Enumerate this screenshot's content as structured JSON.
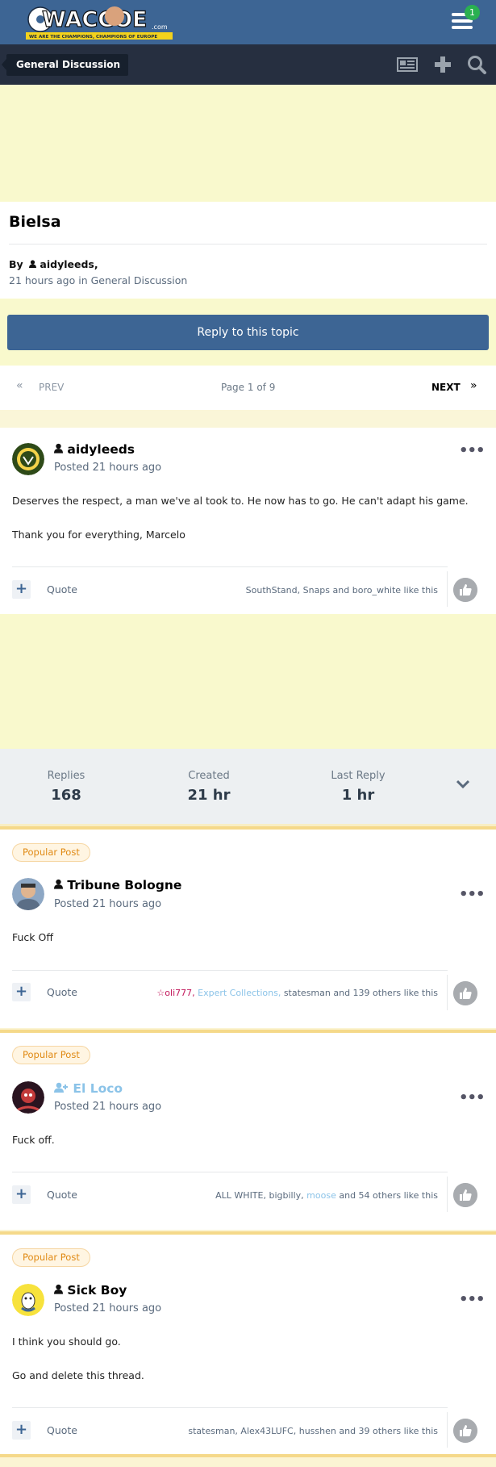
{
  "header": {
    "logo_text": "WACCOE",
    "logo_suffix": ".com",
    "tagline": "WE ARE THE CHAMPIONS, CHAMPIONS OF EUROPE",
    "notification_count": "1"
  },
  "nav": {
    "breadcrumb": "General Discussion"
  },
  "topic": {
    "title": "Bielsa",
    "by_label": "By",
    "author": "aidyleeds,",
    "time": "21 hours ago",
    "in_label": "in",
    "forum": "General Discussion"
  },
  "reply_button": "Reply to this topic",
  "pagination": {
    "prev": "PREV",
    "page": "Page 1 of 9",
    "next": "NEXT"
  },
  "stats": {
    "replies_label": "Replies",
    "replies": "168",
    "created_label": "Created",
    "created": "21 hr",
    "last_label": "Last Reply",
    "last": "1 hr"
  },
  "common": {
    "quote": "Quote",
    "popular": "Popular Post",
    "posted": "Posted 21 hours ago"
  },
  "posts": [
    {
      "author": "aidyleeds",
      "text1": "Deserves the respect, a man we've al took to. He now has to go. He can't adapt his game.",
      "text2": "Thank you for everything, Marcelo",
      "likes": {
        "u1": "SouthStand,",
        "u2": "Snaps",
        "and": " and ",
        "u3": "boro_white",
        "tail": " like this"
      }
    },
    {
      "author": "Tribune Bologne",
      "text1": "Fuck Off",
      "likes": {
        "u1": "oli777,",
        "u2": "Expert Collections,",
        "u3": "statesman",
        "tail": " and 139 others like this"
      }
    },
    {
      "author": "El Loco",
      "text1": "Fuck off.",
      "likes": {
        "u1": "ALL WHITE,",
        "u2": "bigbilly,",
        "u3": "moose",
        "tail": " and 54 others like this"
      }
    },
    {
      "author": "Sick Boy",
      "text1": "I think you should go.",
      "text2": "Go and delete this thread.",
      "likes": {
        "u1": "statesman,",
        "u2": "Alex43LUFC,",
        "u3": "husshen",
        "tail": " and 39 others like this"
      }
    }
  ],
  "colors": {
    "primary": "#3d6594",
    "nav": "#262f40",
    "ad": "#f9f9cd",
    "highlight": "#f5d98a"
  }
}
